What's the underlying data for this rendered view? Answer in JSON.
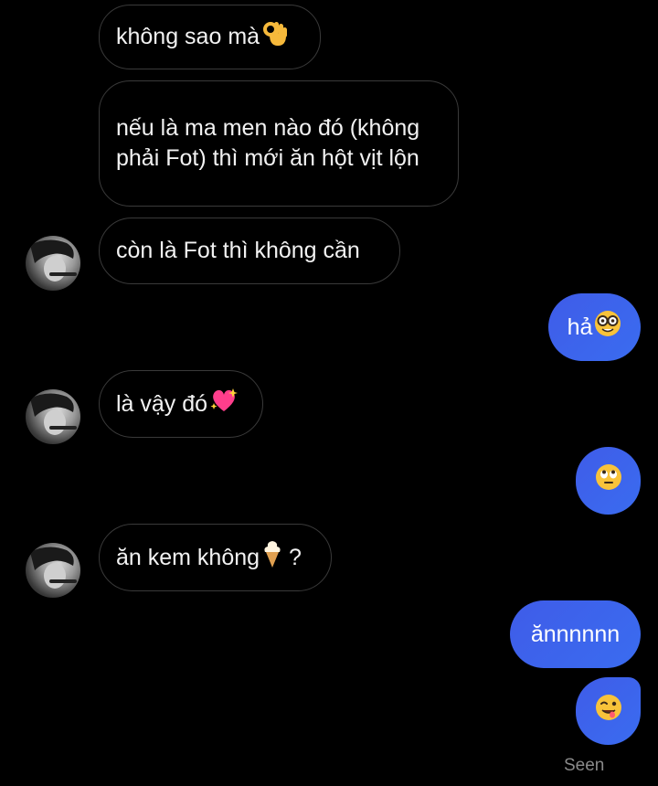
{
  "messages": [
    {
      "text": "không sao mà",
      "emoji": "ok-hand-emoji"
    },
    {
      "text": "nếu là ma men nào đó (không phải Fot) thì mới ăn hột vịt lộn"
    },
    {
      "text": "còn là Fot thì không cần"
    },
    {
      "text": "hả",
      "emoji": "nerd-face-emoji"
    },
    {
      "text": "là vậy đó",
      "emoji": "sparkling-heart-emoji"
    },
    {
      "text": "",
      "emoji": "face-with-rolling-eyes-emoji"
    },
    {
      "text": "ăn kem không",
      "emoji": "soft-ice-cream-emoji",
      "suffix": "?"
    },
    {
      "text": "ănnnnnn"
    },
    {
      "text": "",
      "emoji": "zany-face-emoji"
    }
  ],
  "status": {
    "seen": "Seen"
  },
  "colors": {
    "outgoing": "#3f5ce8",
    "incoming_border": "#3a3a3a",
    "background": "#000000"
  }
}
